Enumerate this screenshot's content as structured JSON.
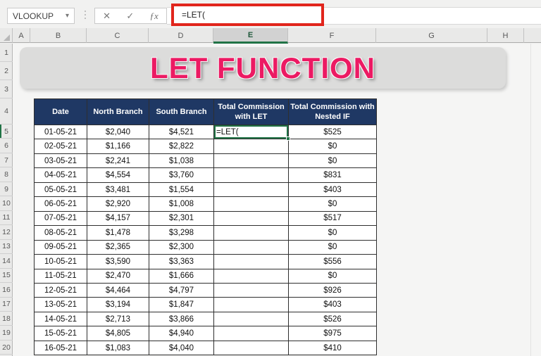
{
  "app": {
    "name_box_value": "VLOOKUP",
    "formula_bar_value": "=LET(",
    "icons": {
      "dropdown": "▾",
      "cancel": "✕",
      "enter": "✓",
      "function": "ƒx"
    }
  },
  "sheet": {
    "column_letters": [
      "A",
      "B",
      "C",
      "D",
      "E",
      "F",
      "G",
      "H"
    ],
    "selected_column": "E",
    "row_numbers": [
      "1",
      "2",
      "3",
      "4",
      "5",
      "6",
      "7",
      "8",
      "9",
      "10",
      "11",
      "12",
      "13",
      "14",
      "15",
      "16",
      "17",
      "18",
      "19",
      "20"
    ],
    "selected_row": "5",
    "active_cell_value": "=LET("
  },
  "banner": {
    "title": "LET FUNCTION"
  },
  "table": {
    "headers": [
      "Date",
      "North Branch",
      "South Branch",
      "Total Commission with LET",
      "Total Commission with Nested IF"
    ],
    "active_cell": {
      "row": 0,
      "col": 3
    },
    "rows": [
      [
        "01-05-21",
        "$2,040",
        "$4,521",
        "=LET(",
        "$525"
      ],
      [
        "02-05-21",
        "$1,166",
        "$2,822",
        "",
        "$0"
      ],
      [
        "03-05-21",
        "$2,241",
        "$1,038",
        "",
        "$0"
      ],
      [
        "04-05-21",
        "$4,554",
        "$3,760",
        "",
        "$831"
      ],
      [
        "05-05-21",
        "$3,481",
        "$1,554",
        "",
        "$403"
      ],
      [
        "06-05-21",
        "$2,920",
        "$1,008",
        "",
        "$0"
      ],
      [
        "07-05-21",
        "$4,157",
        "$2,301",
        "",
        "$517"
      ],
      [
        "08-05-21",
        "$1,478",
        "$3,298",
        "",
        "$0"
      ],
      [
        "09-05-21",
        "$2,365",
        "$2,300",
        "",
        "$0"
      ],
      [
        "10-05-21",
        "$3,590",
        "$3,363",
        "",
        "$556"
      ],
      [
        "11-05-21",
        "$2,470",
        "$1,666",
        "",
        "$0"
      ],
      [
        "12-05-21",
        "$4,464",
        "$4,797",
        "",
        "$926"
      ],
      [
        "13-05-21",
        "$3,194",
        "$1,847",
        "",
        "$403"
      ],
      [
        "14-05-21",
        "$2,713",
        "$3,866",
        "",
        "$526"
      ],
      [
        "15-05-21",
        "$4,805",
        "$4,940",
        "",
        "$975"
      ],
      [
        "16-05-21",
        "$1,083",
        "$4,040",
        "",
        "$410"
      ]
    ]
  },
  "colors": {
    "accent_green": "#217346",
    "header_navy": "#1f3864",
    "title_pink": "#ec1a63",
    "highlight_red": "#e1251c"
  }
}
